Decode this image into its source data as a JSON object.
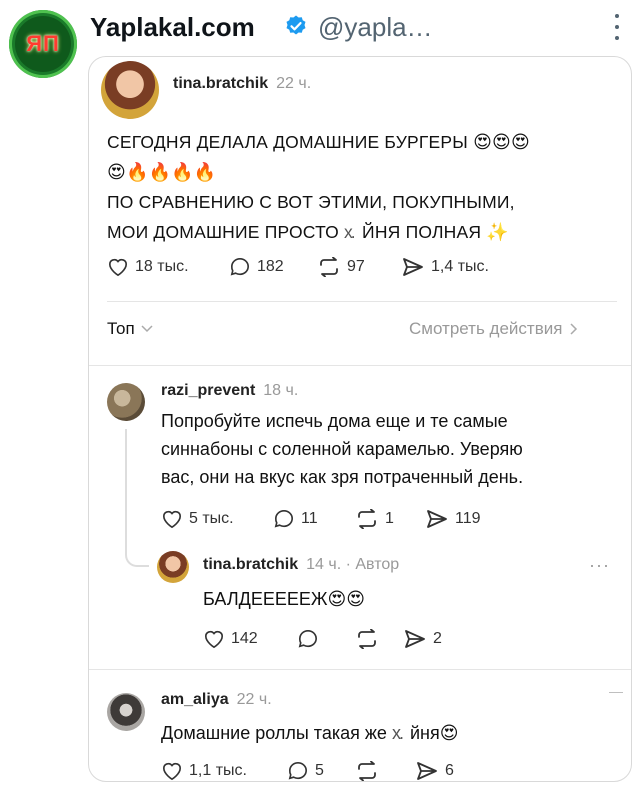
{
  "outer": {
    "logo_text": "ЯП",
    "name": "Yaplakal.com",
    "handle": "@yapla…"
  },
  "post": {
    "author": "tina.bratchik",
    "time": "22 ч.",
    "line1": "СЕГОДНЯ ДЕЛАЛА ДОМАШНИЕ БУРГЕРЫ",
    "line1_emoji": "😍😍😍",
    "line2_emoji": "😍🔥🔥🔥🔥",
    "line3": "ПО СРАВНЕНИЮ С ВОТ ЭТИМИ, ПОКУПНЫМИ,",
    "line4_a": "МОИ ДОМАШНИЕ ПРОСТО",
    "line4_censor": "х.",
    "line4_b": "ЙНЯ ПОЛНАЯ",
    "line4_emoji": "✨",
    "likes": "18 тыс.",
    "replies": "182",
    "reposts": "97",
    "shares": "1,4 тыс."
  },
  "sort": {
    "label": "Топ",
    "see_actions": "Смотреть действия"
  },
  "comments": [
    {
      "author": "razi_prevent",
      "time": "18 ч.",
      "lines": [
        "Попробуйте испечь дома еще и те самые",
        "синнабоны с соленной карамелью. Уверяю",
        "вас, они на вкус как зря потраченный день."
      ],
      "likes": "5 тыс.",
      "replies": "11",
      "reposts": "1",
      "shares": "119"
    },
    {
      "author": "tina.bratchik",
      "time": "14 ч. · Автор",
      "text": "БАЛДЕЕЕЕЕЖ",
      "emoji": "😍😍",
      "likes": "142",
      "shares": "2"
    },
    {
      "author": "am_aliya",
      "time": "22 ч.",
      "text_a": "Домашние роллы такая же",
      "censor": "х.",
      "text_b": "йня",
      "emoji": "😍",
      "likes": "1,1 тыс.",
      "replies": "5",
      "shares": "6"
    }
  ],
  "icons": {
    "heart": "heart-icon",
    "reply": "speech-bubble-icon",
    "repost": "repost-icon",
    "share": "send-icon",
    "verified": "verified-badge-icon",
    "more": "more-icon"
  },
  "colors": {
    "verified": "#1d9bf0",
    "muted": "#999999"
  }
}
